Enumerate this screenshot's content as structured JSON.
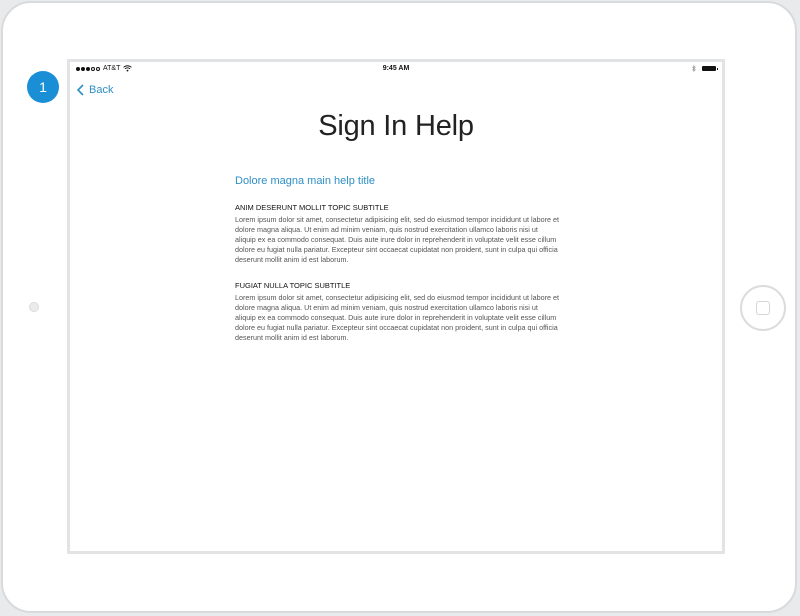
{
  "annotation": {
    "step_number": "1"
  },
  "statusbar": {
    "carrier": "AT&T",
    "time": "9:45 AM"
  },
  "nav": {
    "back_label": "Back"
  },
  "page": {
    "title": "Sign In Help"
  },
  "help": {
    "main_title": "Dolore magna main help title",
    "topics": [
      {
        "subtitle": "ANIM DESERUNT MOLLIT TOPIC SUBTITLE",
        "body": "Lorem ipsum dolor sit amet, consectetur adipisicing elit, sed do eiusmod tempor incididunt ut labore et dolore magna aliqua. Ut enim ad minim veniam, quis nostrud exercitation ullamco laboris nisi ut aliquip ex ea commodo consequat. Duis aute irure dolor in reprehenderit in voluptate velit esse cillum dolore eu fugiat nulla pariatur. Excepteur sint occaecat cupidatat non proident, sunt in culpa qui officia deserunt mollit anim id est laborum."
      },
      {
        "subtitle": "FUGIAT NULLA TOPIC SUBTITLE",
        "body": "Lorem ipsum dolor sit amet, consectetur adipisicing elit, sed do eiusmod tempor incididunt ut labore et dolore magna aliqua. Ut enim ad minim veniam, quis nostrud exercitation ullamco laboris nisi ut aliquip ex ea commodo consequat. Duis aute irure dolor in reprehenderit in voluptate velit esse cillum dolore eu fugiat nulla pariatur. Excepteur sint occaecat cupidatat non proident, sunt in culpa qui officia deserunt mollit anim id est laborum."
      }
    ]
  },
  "colors": {
    "accent": "#2f8fc6",
    "badge": "#1a8fd6"
  },
  "icons": {
    "back": "chevron-left-icon",
    "wifi": "wifi-icon",
    "bluetooth": "bluetooth-icon",
    "battery": "battery-icon",
    "home": "home-button-icon"
  }
}
